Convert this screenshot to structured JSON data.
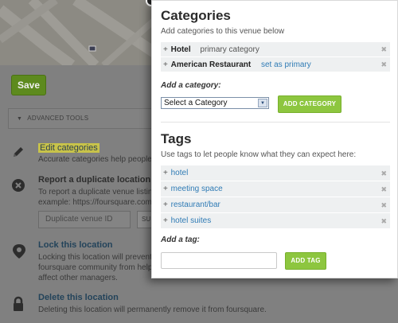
{
  "background": {
    "save_label": "Save",
    "advanced_tools_label": "ADVANCED TOOLS",
    "tools": [
      {
        "title": "Edit categories",
        "desc": "Accurate categories help people"
      },
      {
        "title": "Report a duplicate location",
        "desc": "To report a duplicate venue listin",
        "desc2": "example: https://foursquare.com"
      },
      {
        "title": "Lock this location",
        "desc": "Locking this location will prevent",
        "desc2": "foursquare community from help",
        "desc3": "affect other managers."
      },
      {
        "title": "Delete this location",
        "desc": "Deleting this location will permanently remove it from foursquare."
      }
    ],
    "duplicate_input_placeholder": "Duplicate venue ID",
    "duplicate_submit_label": "SU"
  },
  "modal": {
    "categories": {
      "title": "Categories",
      "subtitle": "Add categories to this venue below",
      "items": [
        {
          "plus": "+",
          "name": "Hotel",
          "meta": "primary category",
          "remove": "✖"
        },
        {
          "plus": "+",
          "name": "American Restaurant",
          "action": "set as primary",
          "remove": "✖"
        }
      ],
      "add_label": "Add a category:",
      "select_value": "Select a Category",
      "add_button": "ADD CATEGORY"
    },
    "tags": {
      "title": "Tags",
      "subtitle": "Use tags to let people know what they can expect here:",
      "items": [
        {
          "plus": "+",
          "name": "hotel",
          "remove": "✖"
        },
        {
          "plus": "+",
          "name": "meeting space",
          "remove": "✖"
        },
        {
          "plus": "+",
          "name": "restaurant/bar",
          "remove": "✖"
        },
        {
          "plus": "+",
          "name": "hotel suites",
          "remove": "✖"
        }
      ],
      "add_label": "Add a tag:",
      "add_button": "ADD TAG"
    }
  },
  "colors": {
    "accent_green": "#8dc63f",
    "link_blue": "#2f7bb5",
    "overlay_gray": "#808080"
  }
}
